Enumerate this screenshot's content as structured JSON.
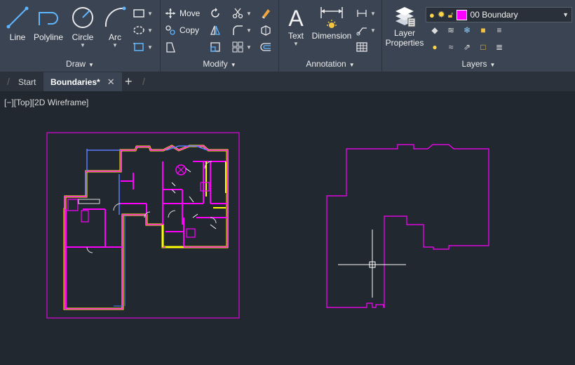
{
  "ribbon": {
    "draw": {
      "title": "Draw",
      "tools": [
        "Line",
        "Polyline",
        "Circle",
        "Arc"
      ]
    },
    "modify": {
      "title": "Modify",
      "move": "Move",
      "copy": "Copy"
    },
    "annotation": {
      "title": "Annotation",
      "text": "Text",
      "dimension": "Dimension"
    },
    "layers": {
      "title": "Layers",
      "layer_properties_line1": "Layer",
      "layer_properties_line2": "Properties",
      "current_layer": "00 Boundary",
      "current_layer_color": "#ff00ff"
    }
  },
  "tabs": {
    "start": "Start",
    "active": "Boundaries*",
    "add": "+"
  },
  "viewport": {
    "label": "[−][Top][2D Wireframe]"
  },
  "colors": {
    "background": "#212830",
    "ribbon": "#3b4453",
    "magenta": "#ff00ff",
    "yellow": "#ffff00",
    "blue": "#5a7bff"
  }
}
